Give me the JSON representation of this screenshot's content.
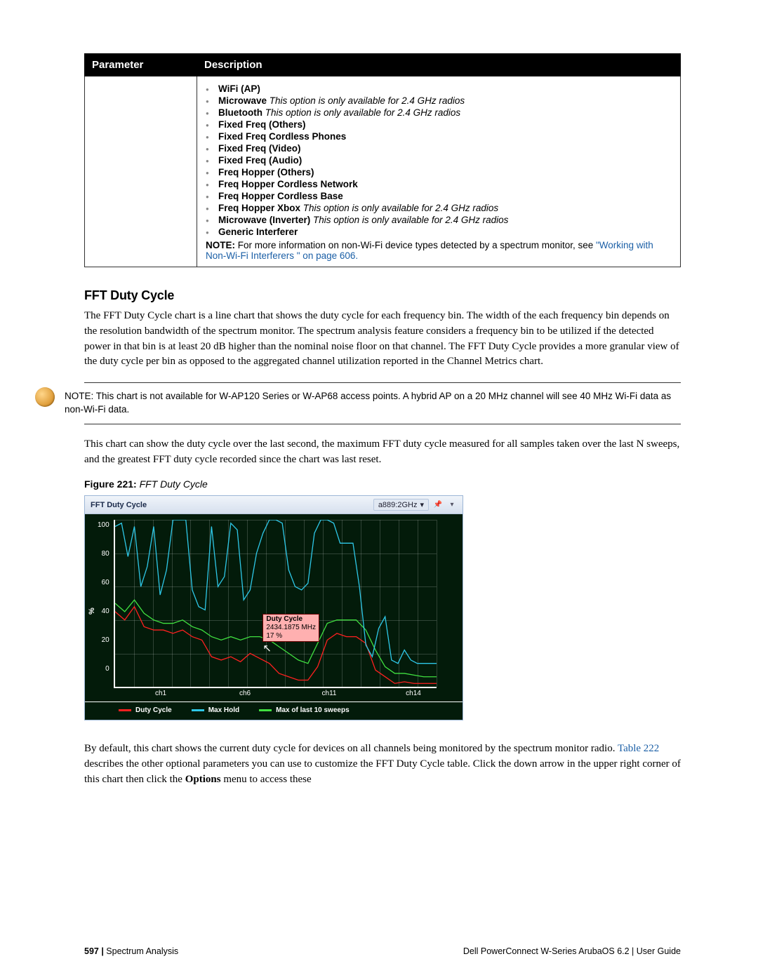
{
  "table": {
    "col_param": "Parameter",
    "col_desc": "Description",
    "items": [
      {
        "label": "WiFi (AP)"
      },
      {
        "label": "Microwave",
        "note": "This option is only available for 2.4 GHz radios"
      },
      {
        "label": "Bluetooth",
        "note": "This option is only available for 2.4 GHz radios"
      },
      {
        "label": "Fixed Freq (Others)"
      },
      {
        "label": "Fixed Freq Cordless Phones"
      },
      {
        "label": "Fixed Freq (Video)"
      },
      {
        "label": "Fixed Freq (Audio)"
      },
      {
        "label": "Freq Hopper (Others)"
      },
      {
        "label": "Freq Hopper Cordless Network"
      },
      {
        "label": "Freq Hopper Cordless Base"
      },
      {
        "label": "Freq Hopper Xbox",
        "note": "This option is only available for 2.4 GHz radios"
      },
      {
        "label": "Microwave (Inverter)",
        "note": "This option is only available for 2.4 GHz radios"
      },
      {
        "label": "Generic Interferer"
      }
    ],
    "note_prefix": "NOTE:",
    "note_text": "For more information on non-Wi-Fi device types detected by a spectrum monitor, see",
    "note_link": "\"Working with Non-Wi-Fi Interferers \" on page 606."
  },
  "section": {
    "title": "FFT Duty Cycle",
    "p1": "The FFT Duty Cycle chart is a line chart that shows the duty cycle for each frequency bin. The width of the each frequency bin depends on the resolution bandwidth of the spectrum monitor. The spectrum analysis feature considers a frequency bin to be utilized if the detected power in that bin is at least 20 dB higher than the nominal noise floor on that channel. The FFT Duty Cycle provides a more granular view of the duty cycle per bin as opposed to the aggregated channel utilization reported in the Channel Metrics chart.",
    "note": "NOTE: This chart is not available for W-AP120 Series or W-AP68 access points.  A hybrid AP on a 20 MHz channel will see 40 MHz Wi-Fi data as non-Wi-Fi data.",
    "p2": "This chart can show the duty cycle over the last second, the maximum FFT duty cycle measured for all samples taken over the last N sweeps, and the greatest FFT duty cycle recorded since the chart was last reset.",
    "figcap_bold": "Figure 221:",
    "figcap_ital": "FFT Duty Cycle",
    "p3a": "By default, this chart shows the current duty cycle for devices on all channels being monitored by the spectrum monitor radio. ",
    "p3_link": "Table 222",
    "p3b": " describes the other optional parameters you can use to customize the FFT Duty Cycle table. Click the down arrow in the upper right corner of this chart then click the ",
    "p3_opt": "Options",
    "p3c": " menu to access these"
  },
  "chart_data": {
    "type": "line",
    "title": "FFT Duty Cycle",
    "radio_selector": "a889:2GHz",
    "ylabel": "%",
    "ylim": [
      0,
      100
    ],
    "y_ticks": [
      "100",
      "80",
      "60",
      "40",
      "20",
      "0"
    ],
    "x_ticks": [
      "ch1",
      "ch6",
      "ch11",
      "ch14"
    ],
    "legend": [
      {
        "name": "Duty Cycle",
        "color": "#ff2020"
      },
      {
        "name": "Max Hold",
        "color": "#2ec8e8"
      },
      {
        "name": "Max of last 10 sweeps",
        "color": "#40e040"
      }
    ],
    "tooltip": {
      "title": "Duty Cycle",
      "line2": "2434.1875 MHz",
      "line3": "17 %"
    },
    "series": [
      {
        "name": "Duty Cycle",
        "color": "#ff2020",
        "points": [
          [
            0,
            45
          ],
          [
            3,
            40
          ],
          [
            6,
            48
          ],
          [
            9,
            36
          ],
          [
            12,
            34
          ],
          [
            15,
            34
          ],
          [
            18,
            32
          ],
          [
            21,
            34
          ],
          [
            24,
            30
          ],
          [
            27,
            28
          ],
          [
            30,
            18
          ],
          [
            33,
            16
          ],
          [
            36,
            18
          ],
          [
            39,
            15
          ],
          [
            42,
            20
          ],
          [
            45,
            17
          ],
          [
            48,
            14
          ],
          [
            51,
            8
          ],
          [
            54,
            6
          ],
          [
            57,
            4
          ],
          [
            60,
            4
          ],
          [
            63,
            12
          ],
          [
            66,
            28
          ],
          [
            69,
            32
          ],
          [
            72,
            30
          ],
          [
            75,
            30
          ],
          [
            78,
            26
          ],
          [
            81,
            10
          ],
          [
            84,
            6
          ],
          [
            87,
            2
          ],
          [
            90,
            3
          ],
          [
            93,
            2
          ],
          [
            96,
            2
          ],
          [
            100,
            2
          ]
        ]
      },
      {
        "name": "Max of last 10 sweeps",
        "color": "#40e040",
        "points": [
          [
            0,
            50
          ],
          [
            3,
            45
          ],
          [
            6,
            52
          ],
          [
            9,
            44
          ],
          [
            12,
            40
          ],
          [
            15,
            38
          ],
          [
            18,
            38
          ],
          [
            21,
            40
          ],
          [
            24,
            36
          ],
          [
            27,
            34
          ],
          [
            30,
            30
          ],
          [
            33,
            28
          ],
          [
            36,
            30
          ],
          [
            39,
            28
          ],
          [
            42,
            30
          ],
          [
            45,
            30
          ],
          [
            48,
            28
          ],
          [
            51,
            24
          ],
          [
            54,
            20
          ],
          [
            57,
            16
          ],
          [
            60,
            14
          ],
          [
            63,
            26
          ],
          [
            66,
            38
          ],
          [
            69,
            40
          ],
          [
            72,
            40
          ],
          [
            75,
            40
          ],
          [
            78,
            34
          ],
          [
            81,
            22
          ],
          [
            84,
            12
          ],
          [
            87,
            8
          ],
          [
            90,
            8
          ],
          [
            93,
            7
          ],
          [
            96,
            6
          ],
          [
            100,
            6
          ]
        ]
      },
      {
        "name": "Max Hold",
        "color": "#2ec8e8",
        "points": [
          [
            0,
            96
          ],
          [
            2,
            98
          ],
          [
            4,
            78
          ],
          [
            6,
            96
          ],
          [
            8,
            60
          ],
          [
            10,
            72
          ],
          [
            12,
            96
          ],
          [
            14,
            55
          ],
          [
            16,
            70
          ],
          [
            18,
            100
          ],
          [
            20,
            100
          ],
          [
            22,
            100
          ],
          [
            24,
            58
          ],
          [
            26,
            48
          ],
          [
            28,
            46
          ],
          [
            30,
            96
          ],
          [
            32,
            60
          ],
          [
            34,
            66
          ],
          [
            36,
            98
          ],
          [
            38,
            94
          ],
          [
            40,
            52
          ],
          [
            42,
            58
          ],
          [
            44,
            80
          ],
          [
            46,
            92
          ],
          [
            48,
            100
          ],
          [
            50,
            100
          ],
          [
            52,
            98
          ],
          [
            54,
            70
          ],
          [
            56,
            60
          ],
          [
            58,
            58
          ],
          [
            60,
            62
          ],
          [
            62,
            92
          ],
          [
            64,
            100
          ],
          [
            66,
            100
          ],
          [
            68,
            98
          ],
          [
            70,
            86
          ],
          [
            72,
            86
          ],
          [
            74,
            86
          ],
          [
            76,
            60
          ],
          [
            78,
            25
          ],
          [
            80,
            18
          ],
          [
            82,
            35
          ],
          [
            84,
            42
          ],
          [
            86,
            16
          ],
          [
            88,
            14
          ],
          [
            90,
            22
          ],
          [
            92,
            16
          ],
          [
            94,
            14
          ],
          [
            96,
            14
          ],
          [
            98,
            14
          ],
          [
            100,
            14
          ]
        ]
      }
    ]
  },
  "footer": {
    "left_bold": "597 |",
    "left_rest": " Spectrum Analysis",
    "right": "Dell PowerConnect W-Series ArubaOS 6.2  |  User Guide"
  }
}
